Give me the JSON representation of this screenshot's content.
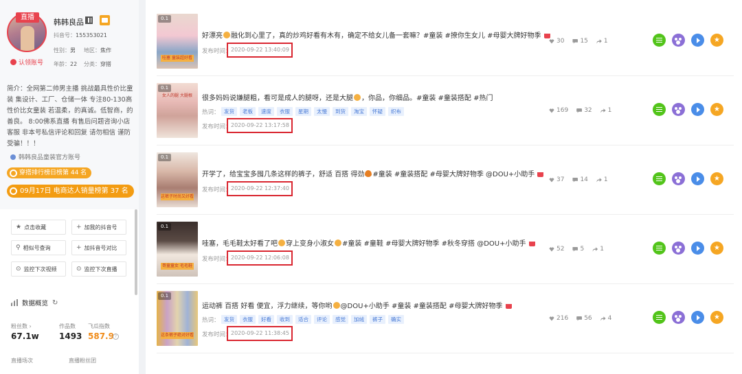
{
  "profile": {
    "live_tag": "直播",
    "name": "韩韩良品",
    "douyin_id_label": "抖音号：",
    "douyin_id": "155353021",
    "gender_label": "性别：",
    "gender": "男",
    "region_label": "地区：",
    "region": "焦作",
    "age_label": "年龄：",
    "age": "22",
    "category_label": "分类：",
    "category": "穿搭",
    "verify_text": "认领账号",
    "bio": "简介：全网第二帅男主播 挑战最具性价比童装 集设计、工厂、仓储一体 专注80-130高性价比女童装 若温柔，的真诚。低智商，的善良。 8:00佛系直播 有售后问题咨询小店客服 非本号私信评论和回复 请勿相信 谨防受骗！！！",
    "official_text": "韩韩良品童装官方账号",
    "rank1": "穿搭排行榜日榜第 44 名",
    "rank2": "09月17日 电商达人销量榜第 37 名"
  },
  "sidebar_buttons": [
    {
      "icon": "★",
      "label": "点击收藏"
    },
    {
      "icon": "+",
      "label": "加我的抖音号"
    },
    {
      "icon": "⚲",
      "label": "相似号查询"
    },
    {
      "icon": "+",
      "label": "加抖音号对比"
    },
    {
      "icon": "⊙",
      "label": "监控下次视频"
    },
    {
      "icon": "⊙",
      "label": "监控下次直播"
    }
  ],
  "data_overview": {
    "title": "数据概览",
    "fans_label": "粉丝数 ›",
    "fans_value": "67.1w",
    "works_label": "作品数",
    "works_value": "1493",
    "gua_label": "飞瓜指数",
    "gua_value": "587.9",
    "live_label": "直播场次",
    "live_fans_label": "直播粉丝团"
  },
  "videos": [
    {
      "badge": "0.1",
      "caption": "哇塞 童装超好看",
      "text_a": "好漂亮",
      "text_b": "融化到心里了，真的炒鸡好看有木有，确定不给女儿备一套嘛？#童装 #撩你生女儿 #母婴大牌好物季",
      "hot_label": "",
      "tags": [],
      "time_label": "发布时间：",
      "time": "2020-09-22 13:40:09",
      "likes": "30",
      "comments": "15",
      "shares": "1"
    },
    {
      "badge": "0.1",
      "caption": "女人的腿 大腿根",
      "text_a": "很多妈妈说嫌腿粗，看可是成人的腿呀，还是大腿",
      "text_b": "，你品，你细品。#童装 #童装搭配 #热门",
      "hot_label": "热词：",
      "tags": [
        "发货",
        "老板",
        "速度",
        "衣服",
        "星期",
        "太慢",
        "到货",
        "淘宝",
        "怀疑",
        "织布"
      ],
      "time_label": "发布时间：",
      "time": "2020-09-22 13:17:58",
      "likes": "169",
      "comments": "32",
      "shares": "1"
    },
    {
      "badge": "0.1",
      "caption": "这裤子时尚又好看",
      "text_a": "开学了，给宝宝多囤几条这样的裤子，舒适 百搭 得劲",
      "text_b": "#童装 #童装搭配 #母婴大牌好物季 @DOU+小助手",
      "hot_label": "",
      "tags": [],
      "time_label": "发布时间：",
      "time": "2020-09-22 12:37:40",
      "likes": "37",
      "comments": "14",
      "shares": "1"
    },
    {
      "badge": "0.1",
      "caption": "哥童童女 毛毛鞋",
      "text_a": "哇塞，毛毛鞋太好看了吧",
      "text_b": "穿上变身小淑女",
      "text_c": "#童装 #童鞋 #母婴大牌好物季 #秋冬穿搭 @DOU+小助手",
      "hot_label": "",
      "tags": [],
      "time_label": "发布时间：",
      "time": "2020-09-22 12:06:08",
      "likes": "52",
      "comments": "5",
      "shares": "1"
    },
    {
      "badge": "0.1",
      "caption": "这条裤子绝对好看",
      "text_a": "运动裤 百搭 好看 便宜，浮力继续，等你哟",
      "text_b": "@DOU+小助手 #童装 #童装搭配 #母婴大牌好物季",
      "hot_label": "热词：",
      "tags": [
        "发货",
        "衣服",
        "好看",
        "收到",
        "适合",
        "评论",
        "感觉",
        "加绒",
        "裤子",
        "确实"
      ],
      "time_label": "发布时间：",
      "time": "2020-09-22 11:38:45",
      "likes": "216",
      "comments": "56",
      "shares": "4"
    }
  ],
  "colors": {
    "accent_red": "#d9252f",
    "tag_blue": "#4a7bd6",
    "rank_orange": "#f5a623",
    "action_green": "#52c41a",
    "action_purple": "#8b6fd6",
    "action_blue": "#4a8de8",
    "action_orange": "#f5a623"
  },
  "icons": [
    "qr-code-icon",
    "shop-icon",
    "verified-icon",
    "rank-icon",
    "data-chart-icon",
    "refresh-icon",
    "heart-icon",
    "comment-icon",
    "share-icon",
    "cart-icon",
    "detail-icon",
    "audience-icon",
    "play-icon",
    "favorite-icon"
  ]
}
